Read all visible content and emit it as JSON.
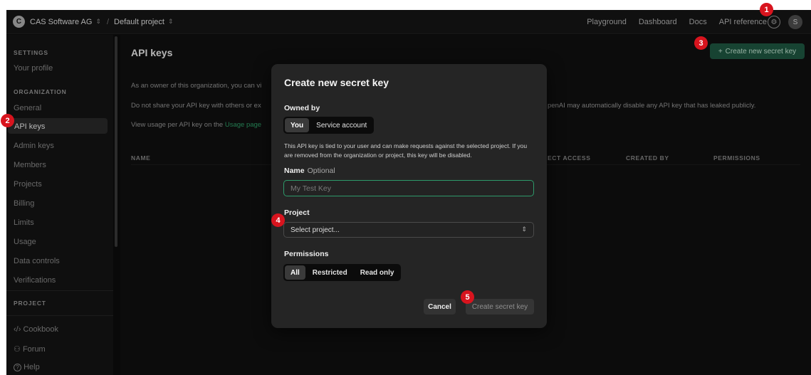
{
  "topbar": {
    "org_initial": "C",
    "org_name": "CAS Software AG",
    "separator": "/",
    "project_name": "Default project",
    "links": [
      "Playground",
      "Dashboard",
      "Docs",
      "API reference"
    ],
    "gear_icon": "gear-icon",
    "avatar_initial": "S"
  },
  "sidebar": {
    "settings_heading": "SETTINGS",
    "your_profile": "Your profile",
    "organization_heading": "ORGANIZATION",
    "items": [
      "General",
      "API keys",
      "Admin keys",
      "Members",
      "Projects",
      "Billing",
      "Limits",
      "Usage",
      "Data controls",
      "Verifications"
    ],
    "active_item": "API keys",
    "project_heading": "PROJECT",
    "footer_items": [
      {
        "icon": "code-icon",
        "glyph": "‹/›",
        "label": "Cookbook"
      },
      {
        "icon": "people-icon",
        "glyph": "⚇",
        "label": "Forum"
      },
      {
        "icon": "help-icon",
        "glyph": "?",
        "label": "Help"
      }
    ]
  },
  "main": {
    "title": "API keys",
    "create_button": "Create new secret key",
    "create_icon": "plus-icon",
    "line1": "As an owner of this organization, you can vi",
    "line2_left": "Do not share your API key with others or ex",
    "line2_right": "penAI may automatically disable any API key that has leaked publicly.",
    "line3_prefix": "View usage per API key on the ",
    "line3_link": "Usage page",
    "columns": [
      "NAME",
      "S",
      "ECT ACCESS",
      "CREATED BY",
      "PERMISSIONS"
    ]
  },
  "modal": {
    "title": "Create new secret key",
    "owned_by_label": "Owned by",
    "owned_by_options": [
      "You",
      "Service account"
    ],
    "owned_by_selected": "You",
    "owned_by_description": "This API key is tied to your user and can make requests against the selected project. If you are removed from the organization or project, this key will be disabled.",
    "name_label": "Name",
    "name_optional": "Optional",
    "name_placeholder": "My Test Key",
    "project_label": "Project",
    "project_select": "Select project...",
    "permissions_label": "Permissions",
    "permission_options": [
      "All",
      "Restricted",
      "Read only"
    ],
    "permission_selected": "All",
    "cancel_button": "Cancel",
    "create_button": "Create secret key"
  },
  "markers": [
    "1",
    "2",
    "3",
    "4",
    "5"
  ],
  "colors": {
    "marker": "#d8141e",
    "accent_green": "#1f5a43",
    "input_focus": "#2d9a6a"
  }
}
